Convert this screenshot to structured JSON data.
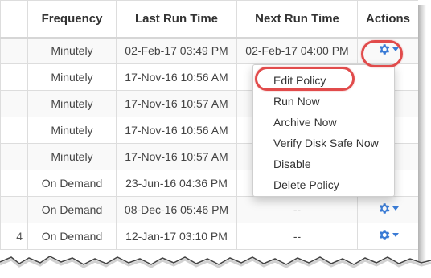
{
  "table": {
    "columns": [
      "",
      "Frequency",
      "Last Run Time",
      "Next Run Time",
      "Actions"
    ],
    "rows": [
      {
        "first": "",
        "frequency": "Minutely",
        "last_run": "02-Feb-17 03:49 PM",
        "next_run": "02-Feb-17 04:00 PM"
      },
      {
        "first": "",
        "frequency": "Minutely",
        "last_run": "17-Nov-16 10:56 AM",
        "next_run": "02"
      },
      {
        "first": "",
        "frequency": "Minutely",
        "last_run": "17-Nov-16 10:57 AM",
        "next_run": "02"
      },
      {
        "first": "",
        "frequency": "Minutely",
        "last_run": "17-Nov-16 10:56 AM",
        "next_run": "02"
      },
      {
        "first": "",
        "frequency": "Minutely",
        "last_run": "17-Nov-16 10:57 AM",
        "next_run": "02"
      },
      {
        "first": "",
        "frequency": "On Demand",
        "last_run": "23-Jun-16 04:36 PM",
        "next_run": ""
      },
      {
        "first": "",
        "frequency": "On Demand",
        "last_run": "08-Dec-16 05:46 PM",
        "next_run": "--"
      },
      {
        "first": "4",
        "frequency": "On Demand",
        "last_run": "12-Jan-17 03:10 PM",
        "next_run": "--"
      }
    ]
  },
  "actions_menu": {
    "items": [
      "Edit Policy",
      "Run Now",
      "Archive Now",
      "Verify Disk Safe Now",
      "Disable",
      "Delete Policy"
    ]
  },
  "colors": {
    "accent": "#3a7bd5",
    "highlight_ring": "#e14b4b",
    "border": "#dddddd"
  },
  "icons": {
    "action_button": "gear-icon",
    "action_caret": "caret-down-icon"
  }
}
